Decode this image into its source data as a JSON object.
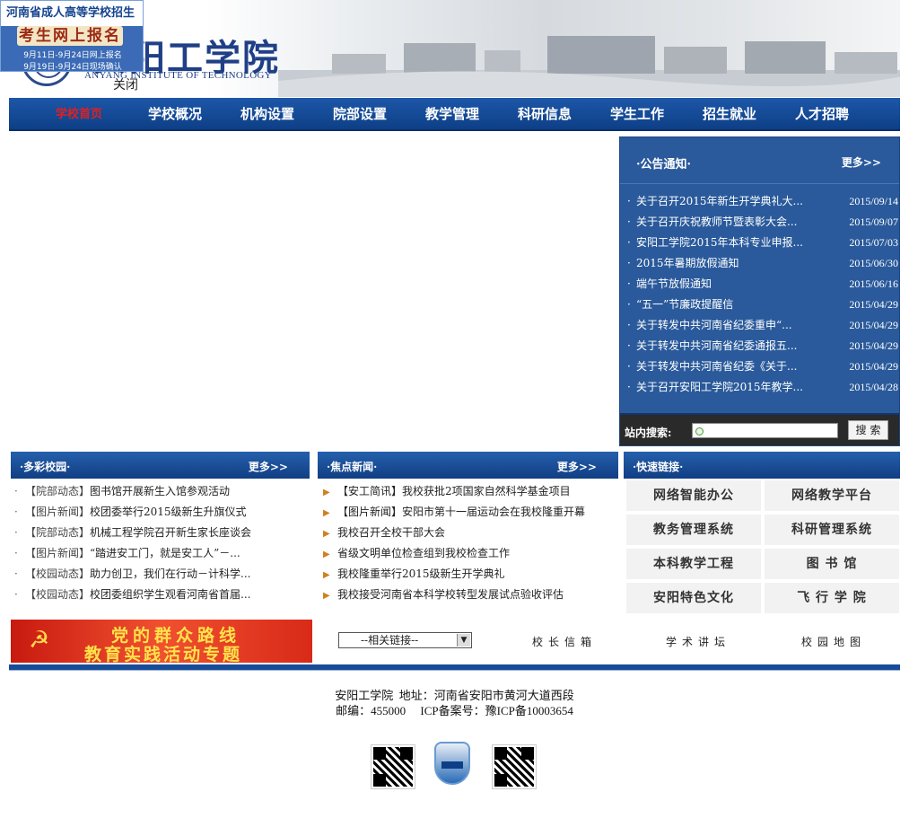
{
  "float_ad": {
    "title": "河南省成人高等学校招生",
    "button": "考生网上报名",
    "date_line1": "9月11日-9月24日网上报名",
    "date_line2": "9月19日-9月24日现场确认",
    "close": "关闭"
  },
  "header": {
    "logo_cn": "安阳工学院",
    "logo_en": "ANYANG INSTITUTE OF TECHNOLOGY"
  },
  "nav": {
    "items": [
      "学校首页",
      "学校概况",
      "机构设置",
      "院部设置",
      "教学管理",
      "科研信息",
      "学生工作",
      "招生就业",
      "人才招聘"
    ]
  },
  "notice": {
    "title": "·公告通知·",
    "more": "更多>>",
    "items": [
      {
        "dot": "·",
        "text": "关于召开2015年新生开学典礼大...",
        "date": "2015/09/14"
      },
      {
        "dot": "·",
        "text": "关于召开庆祝教师节暨表彰大会...",
        "date": "2015/09/07"
      },
      {
        "dot": "·",
        "text": "安阳工学院2015年本科专业申报...",
        "date": "2015/07/03"
      },
      {
        "dot": "·",
        "text": "2015年暑期放假通知",
        "date": "2015/06/30"
      },
      {
        "dot": "·",
        "text": "端午节放假通知",
        "date": "2015/06/16"
      },
      {
        "dot": "·",
        "text": "“五一”节廉政提醒信",
        "date": "2015/04/29"
      },
      {
        "dot": "·",
        "text": "关于转发中共河南省纪委重申“...",
        "date": "2015/04/29"
      },
      {
        "dot": "·",
        "text": "关于转发中共河南省纪委通报五...",
        "date": "2015/04/29"
      },
      {
        "dot": "·",
        "text": "关于转发中共河南省纪委《关于...",
        "date": "2015/04/29"
      },
      {
        "dot": "·",
        "text": "关于召开安阳工学院2015年教学...",
        "date": "2015/04/28"
      }
    ]
  },
  "search": {
    "label": "站内搜索:",
    "button": "搜索",
    "value": ""
  },
  "campus": {
    "title": "·多彩校园·",
    "more": "更多>>",
    "items": [
      {
        "tag": "【院部动态】",
        "text": "图书馆开展新生入馆参观活动"
      },
      {
        "tag": "【图片新闻】",
        "text": "校团委举行2015级新生升旗仪式"
      },
      {
        "tag": "【院部动态】",
        "text": "机械工程学院召开新生家长座谈会"
      },
      {
        "tag": "【图片新闻】",
        "text": "“踏进安工门，就是安工人”－..."
      },
      {
        "tag": "【校园动态】",
        "text": "助力创卫，我们在行动－计科学..."
      },
      {
        "tag": "【校园动态】",
        "text": "校团委组织学生观看河南省首届..."
      }
    ]
  },
  "focus": {
    "title": "·焦点新闻·",
    "more": "更多>>",
    "items": [
      {
        "text": "【安工简讯】我校获批2项国家自然科学基金项目"
      },
      {
        "text": "【图片新闻】安阳市第十一届运动会在我校隆重开幕"
      },
      {
        "text": "我校召开全校干部大会"
      },
      {
        "text": "省级文明单位检查组到我校检查工作"
      },
      {
        "text": "我校隆重举行2015级新生开学典礼"
      },
      {
        "text": "我校接受河南省本科学校转型发展试点验收评估"
      }
    ]
  },
  "quick": {
    "title": "·快速链接·",
    "links": [
      "网络智能办公",
      "网络教学平台",
      "教务管理系统",
      "科研管理系统",
      "本科教学工程",
      "图 书 馆",
      "安阳特色文化",
      "飞 行 学 院"
    ]
  },
  "party_banner": {
    "line1": "党的群众路线",
    "line2": "教育实践活动专题"
  },
  "bottom": {
    "select": "--相关链接--",
    "link1": "校长信箱",
    "link2": "学术讲坛",
    "link3": "校园地图"
  },
  "footer": {
    "line1": "安阳工学院  地址：河南省安阳市黄河大道西段",
    "line2": "邮编：455000     ICP备案号：豫ICP备10003654"
  },
  "colors": {
    "nav_blue": "#0d3f86",
    "notice_blue": "#2a5a9b",
    "active_red": "#e02020"
  }
}
